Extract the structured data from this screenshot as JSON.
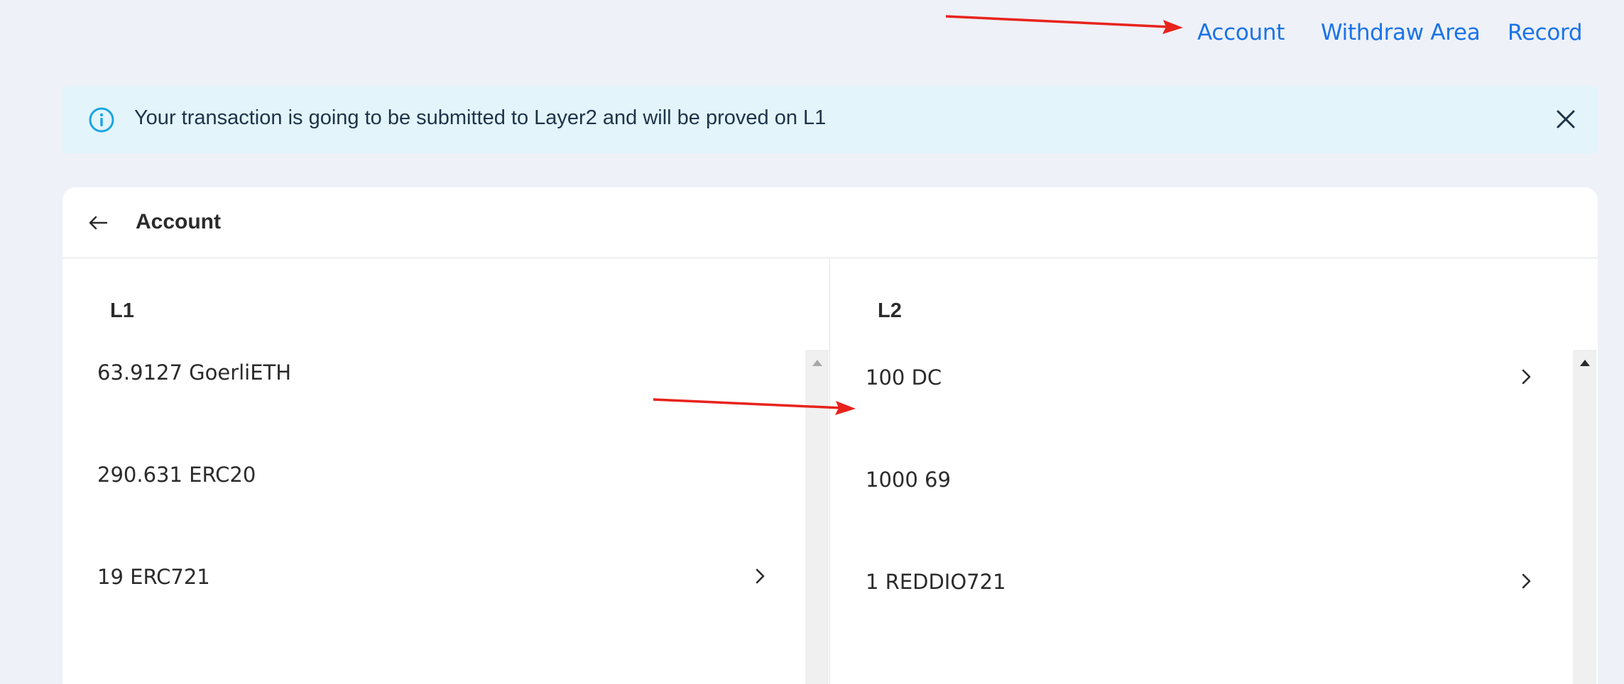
{
  "nav": {
    "account": "Account",
    "withdraw": "Withdraw Area",
    "record": "Record"
  },
  "banner": {
    "message": "Your transaction is going to be submitted to Layer2 and will be proved on L1",
    "icon": "info-icon",
    "close_icon": "close-icon"
  },
  "card": {
    "title": "Account",
    "back_icon": "arrow-left-icon"
  },
  "l1": {
    "heading": "L1",
    "items": [
      {
        "label": "63.9127 GoerliETH",
        "has_chevron": false
      },
      {
        "label": "290.631 ERC20",
        "has_chevron": false
      },
      {
        "label": "19 ERC721",
        "has_chevron": true
      }
    ]
  },
  "l2": {
    "heading": "L2",
    "items": [
      {
        "label": "100 DC",
        "has_chevron": true
      },
      {
        "label": "1000 69",
        "has_chevron": false
      },
      {
        "label": "1 REDDIO721",
        "has_chevron": true
      }
    ]
  },
  "colors": {
    "link": "#1a73e8",
    "banner_bg": "#e3f4fb",
    "info_icon": "#1ba5e0",
    "annotation_arrow": "#e8231c",
    "page_bg": "#eef1f8"
  }
}
